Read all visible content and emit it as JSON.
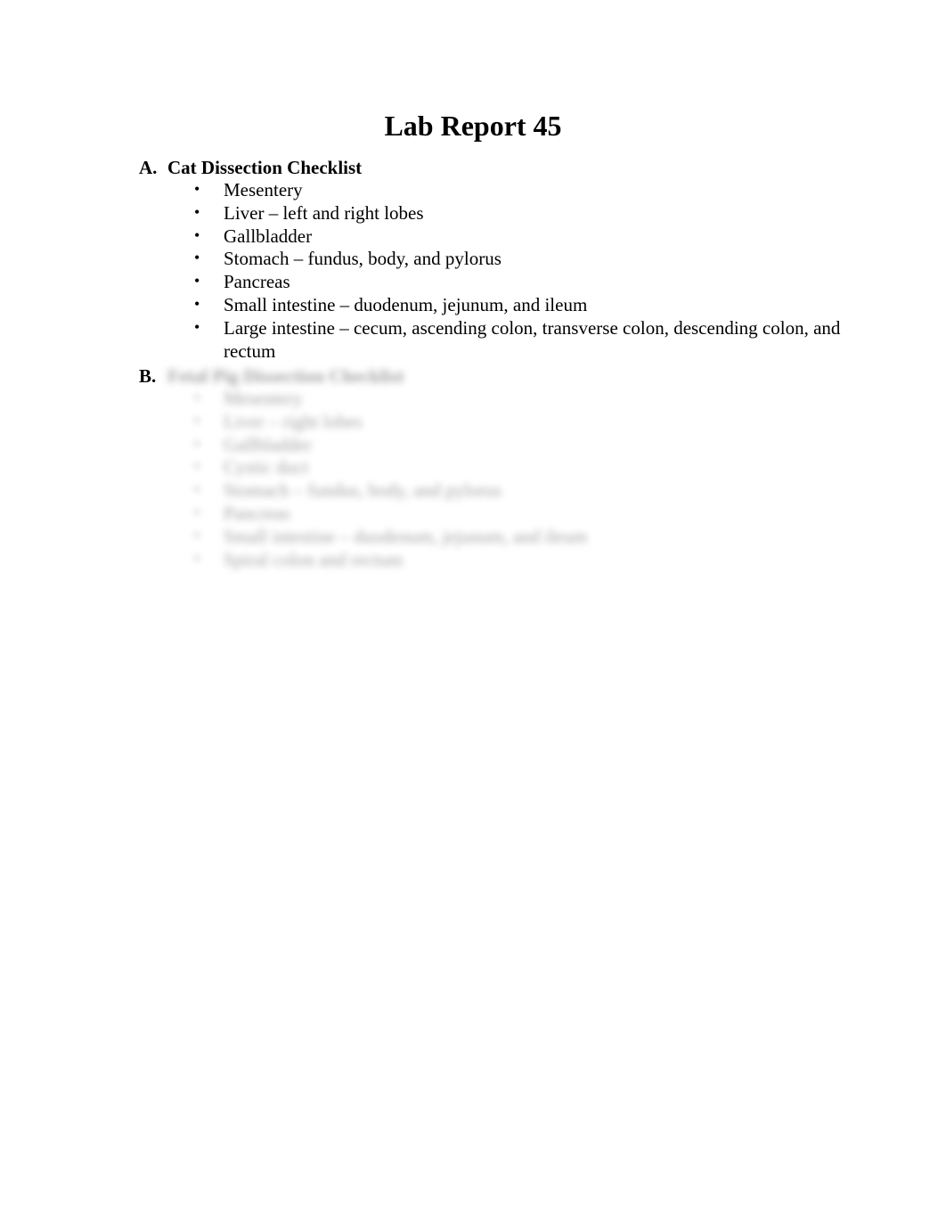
{
  "document": {
    "title": "Lab Report 45",
    "sections": [
      {
        "letter": "A.",
        "heading": "Cat Dissection Checklist",
        "items": [
          "Mesentery",
          "Liver – left and right lobes",
          "Gallbladder",
          "Stomach – fundus, body, and pylorus",
          "Pancreas",
          "Small intestine – duodenum, jejunum, and ileum",
          "Large intestine – cecum, ascending colon, transverse colon, descending colon, and rectum"
        ]
      },
      {
        "letter": "B.",
        "heading": "Fetal Pig Dissection Checklist",
        "blurred": true,
        "items": [
          "Mesentery",
          "Liver – right lobes",
          "Gallbladder",
          "Cystic duct",
          "Stomach – fundus, body, and pylorus",
          "Pancreas",
          "Small intestine – duodenum, jejunum, and ileum",
          "Spiral colon and rectum"
        ]
      }
    ],
    "bullet_glyph": "•"
  }
}
